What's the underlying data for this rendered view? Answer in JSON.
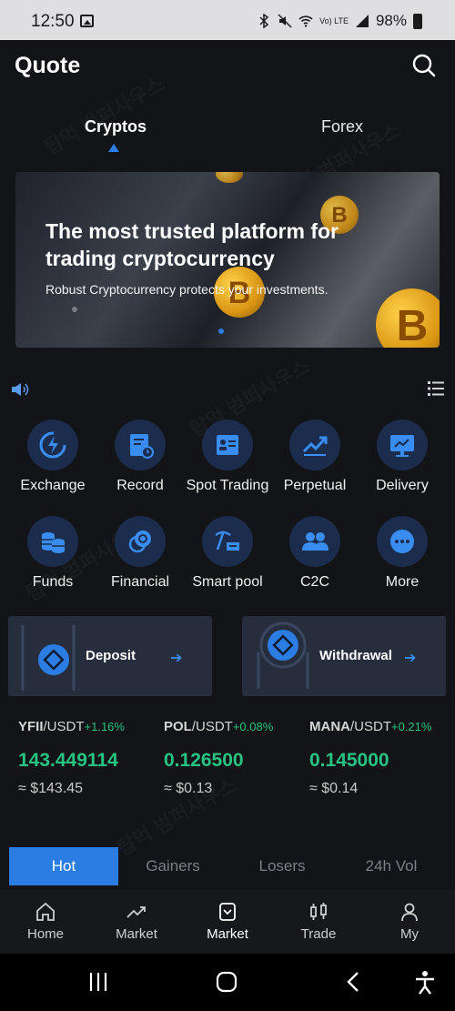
{
  "status_bar": {
    "time": "12:50",
    "signal_text": "Vo) LTE",
    "battery": "98%"
  },
  "header": {
    "title": "Quote"
  },
  "top_tabs": [
    {
      "label": "Cryptos"
    },
    {
      "label": "Forex"
    }
  ],
  "banner": {
    "title": "The most trusted platform for trading cryptocurrency",
    "subtitle": "Robust Cryptocurrency protects your investments.",
    "coin_symbol": "B"
  },
  "grid": [
    {
      "label": "Exchange",
      "icon": "exchange-icon"
    },
    {
      "label": "Record",
      "icon": "record-icon"
    },
    {
      "label": "Spot Trading",
      "icon": "spot-trading-icon"
    },
    {
      "label": "Perpetual",
      "icon": "perpetual-icon"
    },
    {
      "label": "Delivery",
      "icon": "delivery-icon"
    },
    {
      "label": "Funds",
      "icon": "funds-icon"
    },
    {
      "label": "Financial",
      "icon": "financial-icon"
    },
    {
      "label": "Smart pool",
      "icon": "smart-pool-icon"
    },
    {
      "label": "C2C",
      "icon": "c2c-icon"
    },
    {
      "label": "More",
      "icon": "more-icon"
    }
  ],
  "actions": {
    "deposit": "Deposit",
    "withdrawal": "Withdrawal"
  },
  "tickers": [
    {
      "pair_base": "YFII",
      "pair_quote": "/USDT",
      "change": "+1.16%",
      "price": "143.449114",
      "usd": "≈ $143.45"
    },
    {
      "pair_base": "POL",
      "pair_quote": "/USDT",
      "change": "+0.08%",
      "price": "0.126500",
      "usd": "≈ $0.13"
    },
    {
      "pair_base": "MANA",
      "pair_quote": "/USDT",
      "change": "+0.21%",
      "price": "0.145000",
      "usd": "≈ $0.14"
    }
  ],
  "sort_tabs": [
    {
      "label": "Hot"
    },
    {
      "label": "Gainers"
    },
    {
      "label": "Losers"
    },
    {
      "label": "24h Vol"
    }
  ],
  "bottom_nav": [
    {
      "label": "Home",
      "icon": "home-icon"
    },
    {
      "label": "Market",
      "icon": "market-chart-icon"
    },
    {
      "label": "Market",
      "icon": "market-box-icon"
    },
    {
      "label": "Trade",
      "icon": "trade-icon"
    },
    {
      "label": "My",
      "icon": "profile-icon"
    }
  ],
  "colors": {
    "accent": "#2b7de3",
    "positive": "#27c383",
    "background": "#131417"
  },
  "watermark": "탑먹 범퍼사우스"
}
